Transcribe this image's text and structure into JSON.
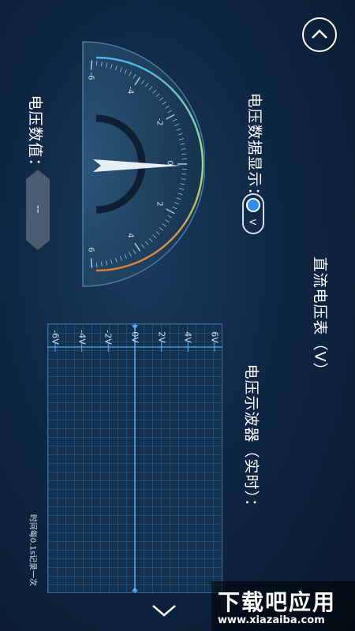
{
  "header": {
    "up_icon": "chevron-up-icon"
  },
  "meter": {
    "title": "直流电压表（V）",
    "display_label": "电压数据显示：",
    "unit_toggle": "V",
    "value_label": "电压数值：",
    "value": "--",
    "scale": [
      "-6",
      "-4",
      "-2",
      "0",
      "2",
      "4",
      "6"
    ],
    "needle_value": 0
  },
  "oscilloscope": {
    "title": "电压示波器（实时）：",
    "axis": [
      "-6V",
      "-4V",
      "-2V",
      "0V",
      "2V",
      "4V",
      "6V"
    ],
    "note": "时间每0.1s记录一次"
  },
  "footer": {
    "down_icon": "chevron-down-icon"
  },
  "watermark": {
    "line1": "下载吧应用",
    "line2": "www.xiazaiba.com"
  },
  "colors": {
    "accent": "#2d8cf0",
    "gauge_low": "#4fb3e8",
    "gauge_mid": "#9be08a",
    "gauge_high": "#e07a3a"
  }
}
